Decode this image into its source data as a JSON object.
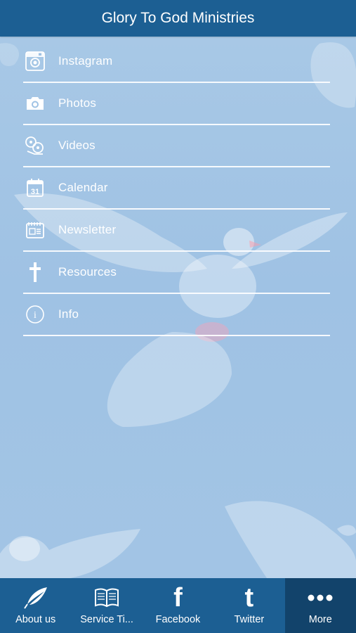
{
  "header": {
    "title": "Glory To God Ministries"
  },
  "menu": {
    "items": [
      {
        "label": "Instagram",
        "icon": "instagram-icon"
      },
      {
        "label": "Photos",
        "icon": "camera-icon"
      },
      {
        "label": "Videos",
        "icon": "film-reel-icon"
      },
      {
        "label": "Calendar",
        "icon": "calendar-icon",
        "icon_text": "31"
      },
      {
        "label": "Newsletter",
        "icon": "newsletter-icon"
      },
      {
        "label": "Resources",
        "icon": "cross-icon"
      },
      {
        "label": "Info",
        "icon": "info-icon",
        "icon_text": "i"
      }
    ]
  },
  "tabbar": {
    "tabs": [
      {
        "label": "About us",
        "icon": "quill-icon",
        "active": false
      },
      {
        "label": "Service Ti...",
        "icon": "book-icon",
        "active": false
      },
      {
        "label": "Facebook",
        "icon": "facebook-icon",
        "icon_text": "f",
        "active": false
      },
      {
        "label": "Twitter",
        "icon": "twitter-icon",
        "icon_text": "t",
        "active": false
      },
      {
        "label": "More",
        "icon": "more-icon",
        "active": true
      }
    ]
  },
  "colors": {
    "bar": "#1c5f93",
    "active_tab": "#12436b",
    "background": "#a3c5e5",
    "text": "#ffffff"
  }
}
